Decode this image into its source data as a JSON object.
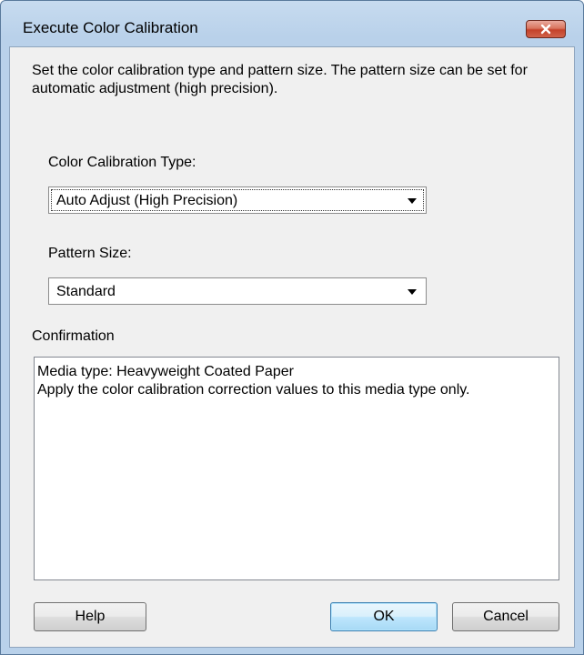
{
  "window": {
    "title": "Execute Color Calibration"
  },
  "description": "Set the color calibration type and pattern size. The pattern size can be set for automatic adjustment (high precision).",
  "calibration_type": {
    "label": "Color Calibration Type:",
    "selected": "Auto Adjust (High Precision)"
  },
  "pattern_size": {
    "label": "Pattern Size:",
    "selected": "Standard"
  },
  "confirmation": {
    "label": "Confirmation",
    "line1": "Media type: Heavyweight Coated Paper",
    "line2": "Apply the color calibration correction values to this media type only."
  },
  "buttons": {
    "help": "Help",
    "ok": "OK",
    "cancel": "Cancel"
  },
  "colors": {
    "frame": "#b9d1ea",
    "client": "#f0f0f0",
    "close_button": "#c4412a",
    "default_button_border": "#3c7fb1"
  }
}
